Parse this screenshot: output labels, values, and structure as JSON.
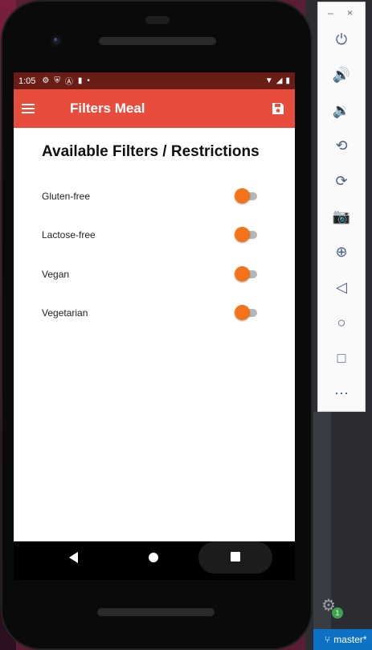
{
  "status_bar": {
    "time": "1:05",
    "dot": "•"
  },
  "app_bar": {
    "title": "Filters Meal",
    "menu_icon": "menu-icon",
    "save_icon": "save-icon",
    "color": "#e84c3d"
  },
  "content": {
    "heading": "Available Filters / Restrictions",
    "filters": [
      {
        "label": "Gluten-free",
        "enabled": true
      },
      {
        "label": "Lactose-free",
        "enabled": true
      },
      {
        "label": "Vegan",
        "enabled": true
      },
      {
        "label": "Vegetarian",
        "enabled": true
      }
    ]
  },
  "theme": {
    "accent": "#f47318",
    "status_bar_bg": "#6a1d17"
  },
  "nav_bar": {
    "back": "back-icon",
    "home": "home-icon",
    "recents": "recents-icon"
  },
  "emulator_panel": {
    "minimize": "–",
    "close": "×",
    "buttons": [
      {
        "name": "power-icon",
        "glyph": "⏻"
      },
      {
        "name": "volume-up-icon",
        "glyph": "🔊"
      },
      {
        "name": "volume-down-icon",
        "glyph": "🔉"
      },
      {
        "name": "rotate-left-icon",
        "glyph": "⟲"
      },
      {
        "name": "rotate-right-icon",
        "glyph": "⟳"
      },
      {
        "name": "camera-icon",
        "glyph": "📷"
      },
      {
        "name": "zoom-icon",
        "glyph": "⊕"
      },
      {
        "name": "back-icon",
        "glyph": "◁"
      },
      {
        "name": "home-icon",
        "glyph": "○"
      },
      {
        "name": "overview-icon",
        "glyph": "□"
      },
      {
        "name": "more-icon",
        "glyph": "⋯"
      }
    ]
  },
  "editor_status": {
    "branch": "master*",
    "notification_count": "1"
  }
}
